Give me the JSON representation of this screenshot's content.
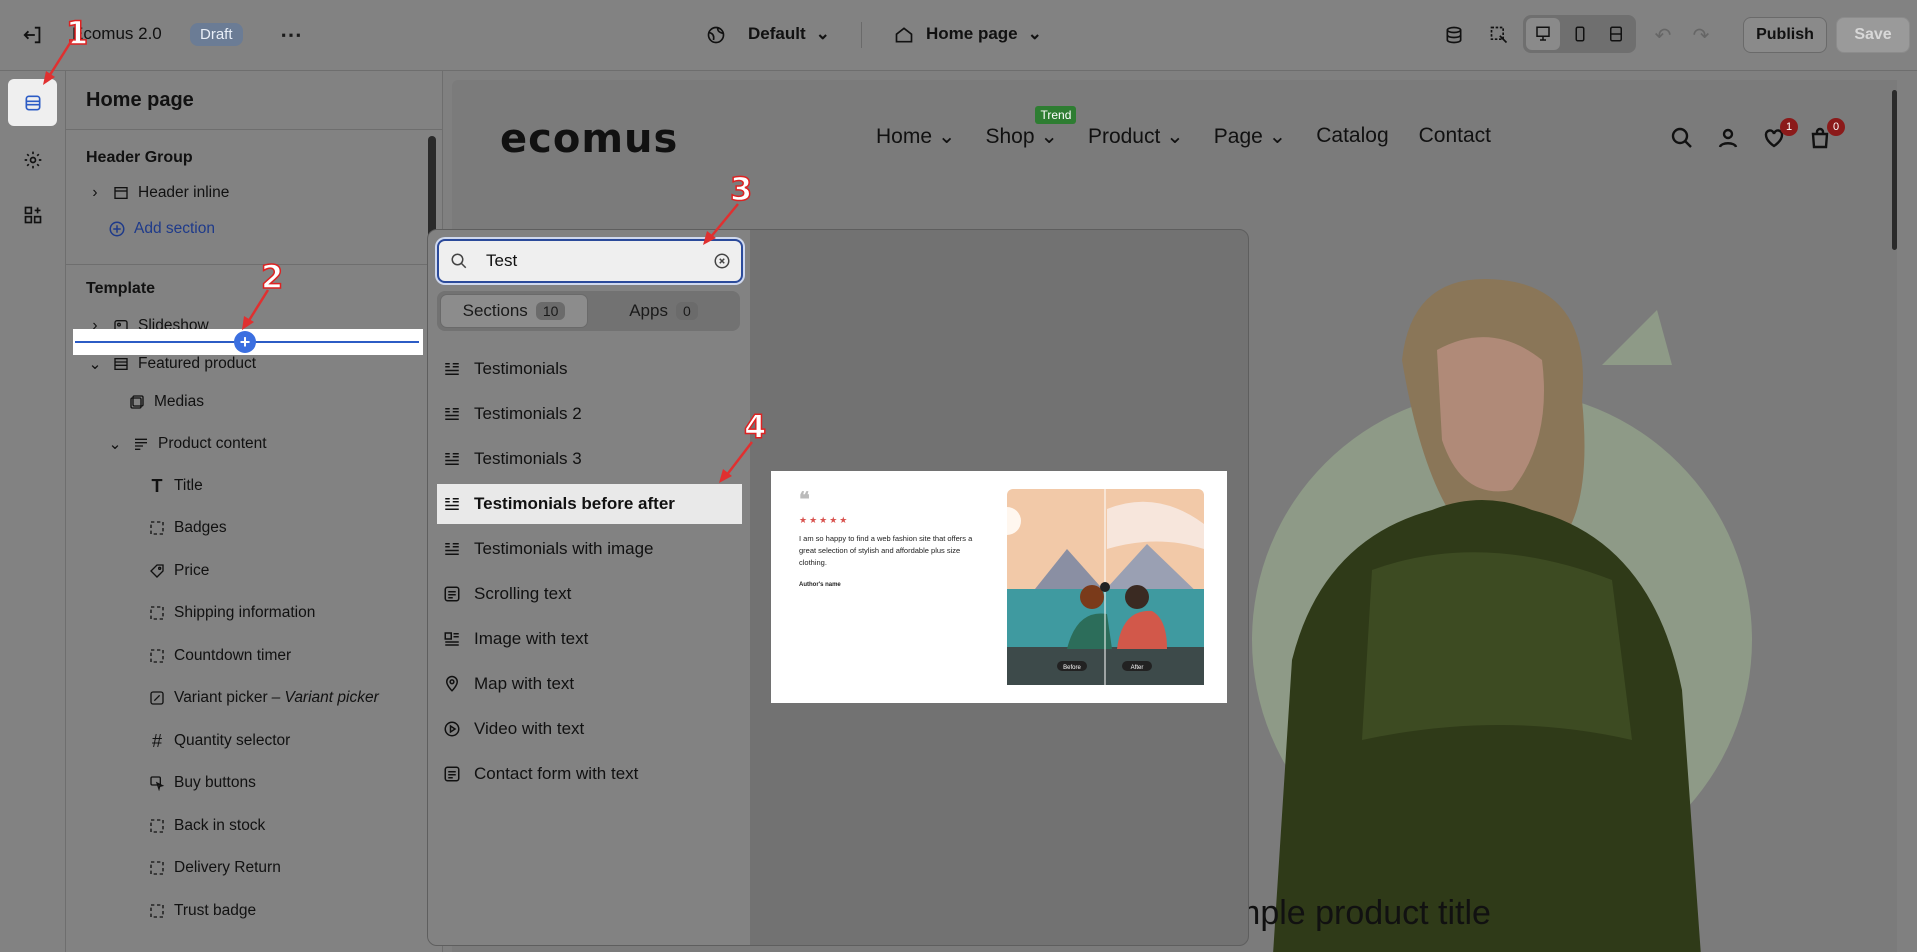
{
  "topbar": {
    "store_name": "Ecomus 2.0",
    "status_badge": "Draft",
    "theme_selector": "Default",
    "page_selector": "Home page",
    "publish_label": "Publish",
    "save_label": "Save"
  },
  "panel": {
    "title": "Home page",
    "header_group": {
      "heading": "Header Group",
      "items": [
        "Header inline"
      ],
      "add_section_label": "Add section"
    },
    "template": {
      "heading": "Template",
      "slideshow": "Slideshow",
      "featured_product": "Featured product",
      "medias": "Medias",
      "product_content": "Product content",
      "blocks": [
        {
          "label": "Title",
          "icon": "text-icon"
        },
        {
          "label": "Badges",
          "icon": "block-icon"
        },
        {
          "label": "Price",
          "icon": "price-tag-icon"
        },
        {
          "label": "Shipping information",
          "icon": "block-icon"
        },
        {
          "label": "Countdown timer",
          "icon": "block-icon"
        },
        {
          "label": "Variant picker",
          "subtitle": "– Variant picker",
          "icon": "variant-icon"
        },
        {
          "label": "Quantity selector",
          "icon": "hash-icon"
        },
        {
          "label": "Buy buttons",
          "icon": "cursor-icon"
        },
        {
          "label": "Back in stock",
          "icon": "block-icon"
        },
        {
          "label": "Delivery Return",
          "icon": "block-icon"
        },
        {
          "label": "Trust badge",
          "icon": "block-icon"
        }
      ]
    }
  },
  "preview": {
    "logo": "ecomus",
    "nav": [
      "Home",
      "Shop",
      "Product",
      "Page",
      "Catalog",
      "Contact"
    ],
    "trend_badge": "Trend",
    "wishlist_count": "1",
    "cart_count": "0",
    "product_title_fragment": "mple product title"
  },
  "popup": {
    "search_value": "Test",
    "tabs": [
      {
        "label": "Sections",
        "count": "10"
      },
      {
        "label": "Apps",
        "count": "0"
      }
    ],
    "results": [
      "Testimonials",
      "Testimonials 2",
      "Testimonials 3",
      "Testimonials before after",
      "Testimonials with image",
      "Scrolling text",
      "Image with text",
      "Map with text",
      "Video with text",
      "Contact form with text"
    ],
    "selected_index": 3,
    "thumbnail": {
      "quote": "I am so happy to find a web fashion site that offers a great selection of stylish and affordable plus size clothing.",
      "author": "Author's name",
      "before_label": "Before",
      "after_label": "After"
    }
  },
  "annotations": [
    "1",
    "2",
    "3",
    "4"
  ],
  "colors": {
    "accent_blue": "#2c5cc5",
    "callout_red": "#d22222",
    "trend_green": "#2e7d32"
  }
}
